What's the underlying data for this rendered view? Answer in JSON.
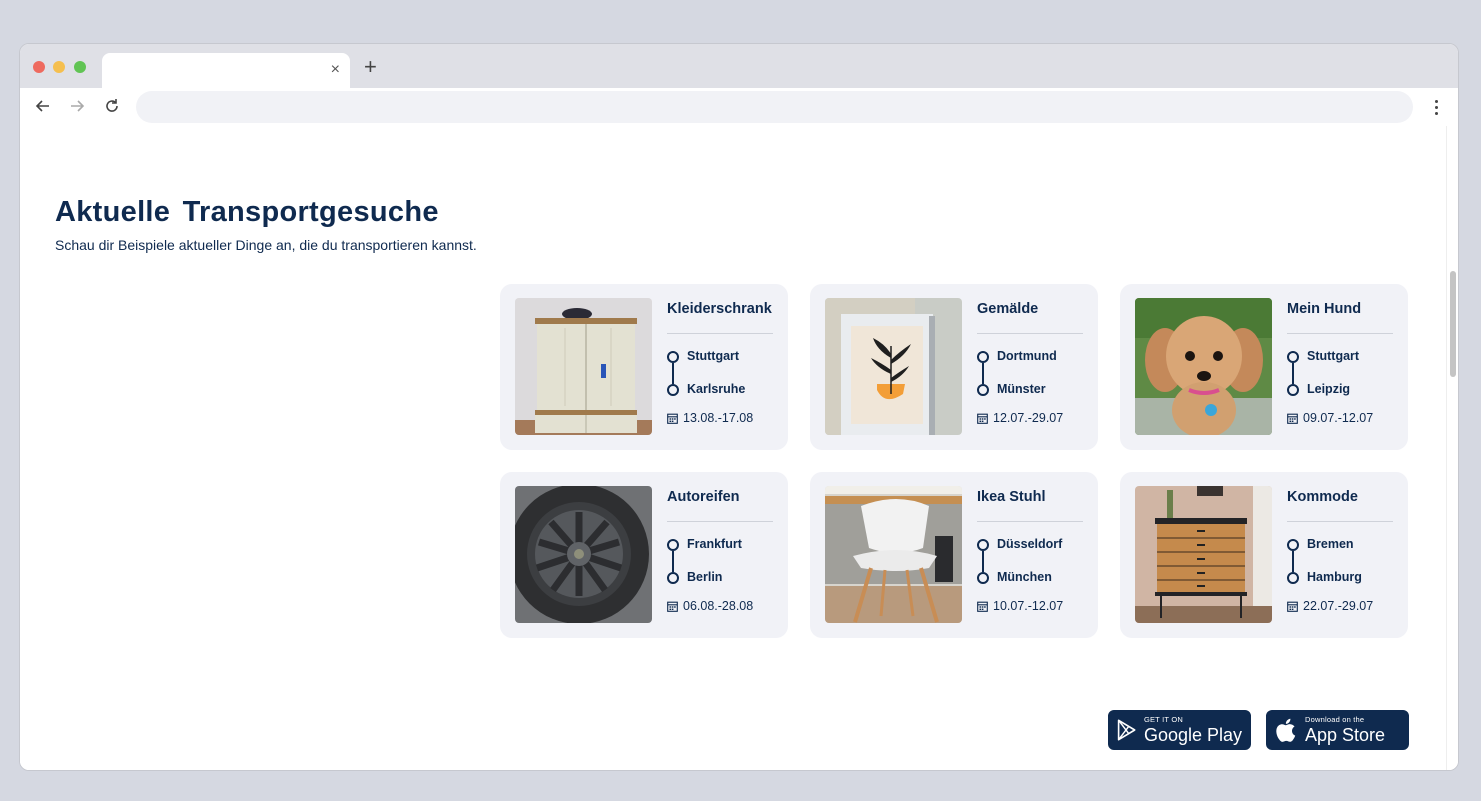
{
  "browser": {
    "tab_close": "×",
    "new_tab": "+"
  },
  "page": {
    "title": "Aktuelle Transportgesuche",
    "subtitle": "Schau dir Beispiele aktueller Dinge an, die du transportieren kannst."
  },
  "cards": [
    {
      "title": "Kleiderschrank",
      "from": "Stuttgart",
      "to": "Karlsruhe",
      "date": "13.08.-17.08",
      "image": "wardrobe-photo"
    },
    {
      "title": "Gemälde",
      "from": "Dortmund",
      "to": "Münster",
      "date": "12.07.-29.07",
      "image": "painting-photo"
    },
    {
      "title": "Mein Hund",
      "from": "Stuttgart",
      "to": "Leipzig",
      "date": "09.07.-12.07",
      "image": "dog-photo"
    },
    {
      "title": "Autoreifen",
      "from": "Frankfurt",
      "to": "Berlin",
      "date": "06.08.-28.08",
      "image": "tire-photo"
    },
    {
      "title": "Ikea Stuhl",
      "from": "Düsseldorf",
      "to": "München",
      "date": "10.07.-12.07",
      "image": "chair-photo"
    },
    {
      "title": "Kommode",
      "from": "Bremen",
      "to": "Hamburg",
      "date": "22.07.-29.07",
      "image": "dresser-photo"
    }
  ],
  "badges": {
    "google_play": {
      "small": "GET IT ON",
      "big": "Google Play"
    },
    "app_store": {
      "small": "Download on the",
      "big": "App Store"
    }
  },
  "colors": {
    "primary": "#0f2a4f",
    "card_bg": "#f1f2f7"
  }
}
